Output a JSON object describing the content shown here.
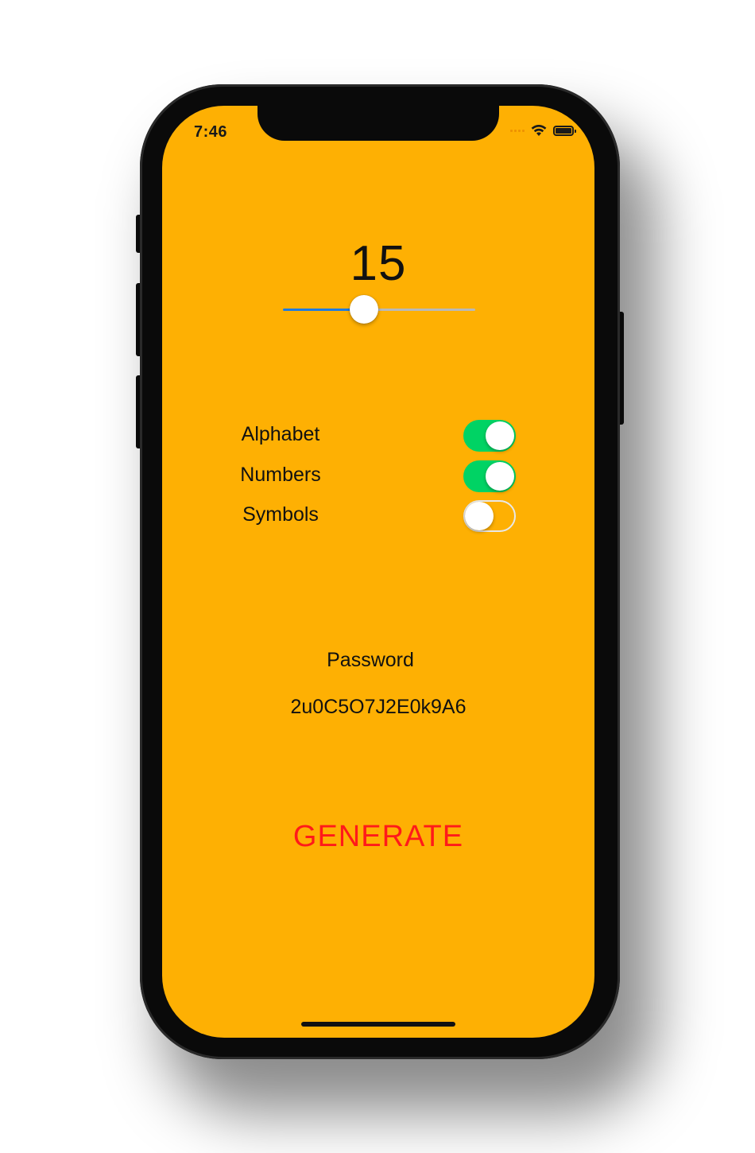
{
  "status_bar": {
    "time": "7:46",
    "icons": [
      "signal-icon",
      "wifi-icon",
      "battery-icon"
    ]
  },
  "length": {
    "value": "15",
    "slider_fraction": 0.42
  },
  "options": [
    {
      "label": "Alphabet",
      "enabled": true
    },
    {
      "label": "Numbers",
      "enabled": true
    },
    {
      "label": "Symbols",
      "enabled": false
    }
  ],
  "password": {
    "label": "Password",
    "value": "2u0C5O7J2E0k9A6"
  },
  "generate_button": {
    "label": "GENERATE"
  },
  "colors": {
    "background": "#FEB003",
    "toggle_on": "#00D364",
    "generate_text": "#FF1A1A",
    "slider_fill": "#1F7BE0"
  }
}
